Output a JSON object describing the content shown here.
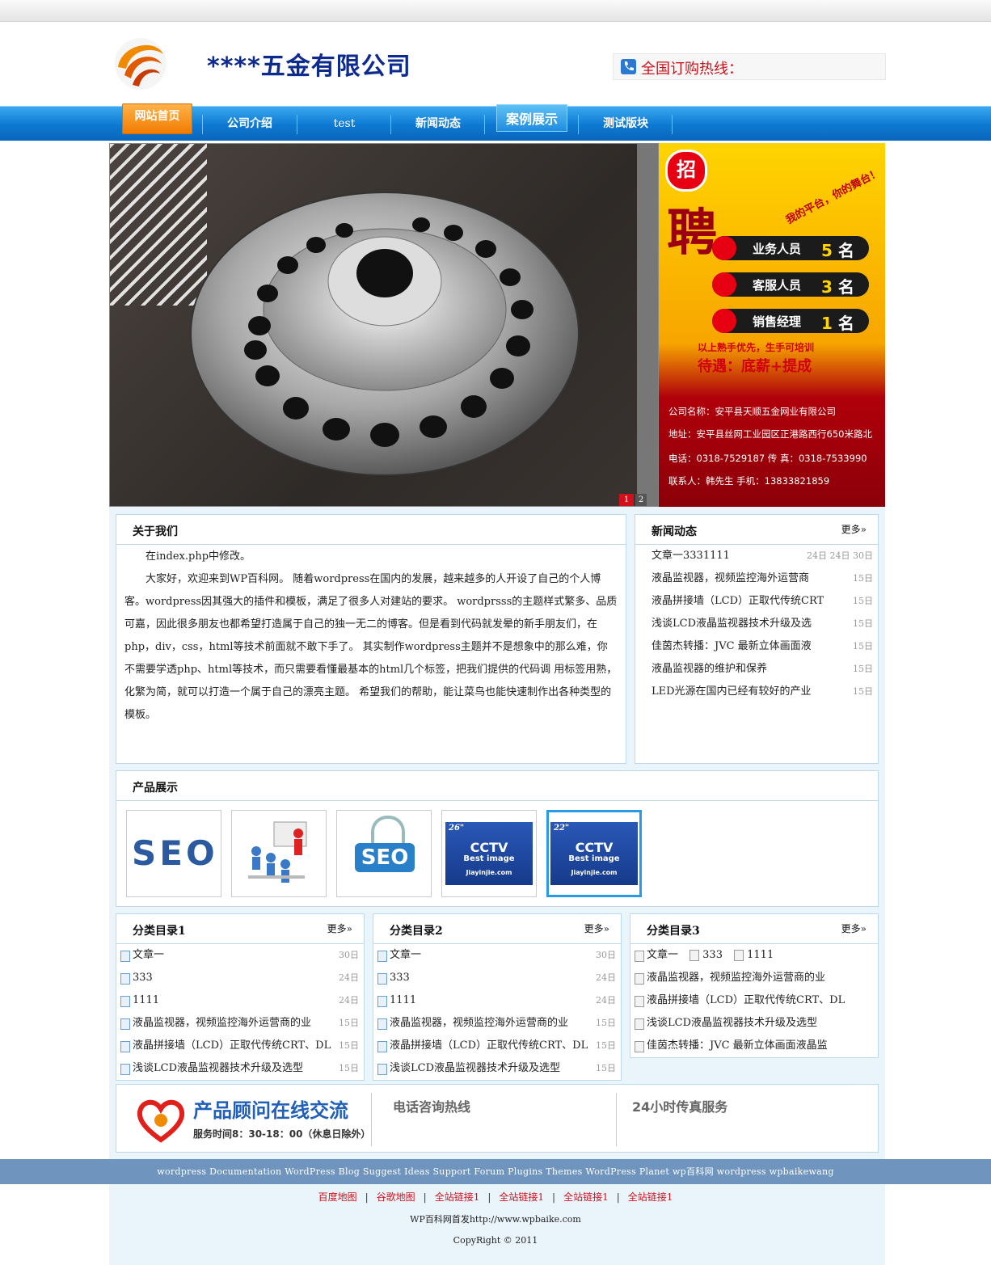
{
  "header": {
    "site_title": "****五金有限公司",
    "hotline_label": "全国订购热线：",
    "brand_color": "#0d2b8f",
    "hotline_color": "#d0101a"
  },
  "nav": {
    "items": [
      "网站首页",
      "公司介绍",
      "test",
      "新闻动态",
      "案例展示",
      "测试版块"
    ],
    "active_bg": "#f07c00",
    "bar_color": "#0d78d2"
  },
  "banner": {
    "pager": [
      "1",
      "2"
    ],
    "ad": {
      "badge": "招",
      "headline": "聘",
      "slogan": "我的平台，你的舞台！",
      "positions": [
        {
          "role": "业务人员",
          "count": "5",
          "unit": "名"
        },
        {
          "role": "客服人员",
          "count": "3",
          "unit": "名"
        },
        {
          "role": "销售经理",
          "count": "1",
          "unit": "名"
        }
      ],
      "perk_line1": "以上熟手优先，生手可培训",
      "perk_line2": "待遇：底薪+提成",
      "info": [
        "公司名称：安平县天顺五金网业有限公司",
        "地址：安平县丝网工业园区正港路西行650米路北",
        "电话：0318-7529187 传 真：0318-7533990",
        "联系人：韩先生 手机：13833821859"
      ]
    }
  },
  "about": {
    "title": "关于我们",
    "paragraphs": [
      "在index.php中修改。",
      "大家好，欢迎来到WP百科网。 随着wordpress在国内的发展，越来越多的人开设了自己的个人博客。wordpress因其强大的插件和模板，满足了很多人对建站的要求。 wordprsss的主题样式繁多、品质可嘉，因此很多朋友也都希望打造属于自己的独一无二的博客。但是看到代码就发晕的新手朋友们，在 php，div，css，html等技术前面就不敢下手了。 其实制作wordpress主题并不是想象中的那么难，你不需要学透php、html等技术，而只需要看懂最基本的html几个标签，把我们提供的代码调 用标签用熟，化繁为简，就可以打造一个属于自己的漂亮主题。 希望我们的帮助，能让菜鸟也能快速制作出各种类型的模板。"
    ]
  },
  "news": {
    "title": "新闻动态",
    "more": "更多»",
    "items": [
      {
        "text": "文章一3331111",
        "date": "24日 24日 30日"
      },
      {
        "text": "液晶监视器，视频监控海外运营商",
        "date": "15日"
      },
      {
        "text": "液晶拼接墙（LCD）正取代传统CRT",
        "date": "15日"
      },
      {
        "text": "浅谈LCD液晶监视器技术升级及选",
        "date": "15日"
      },
      {
        "text": "佳茵杰转播：JVC 最新立体画面液",
        "date": "15日"
      },
      {
        "text": "液晶监视器的维护和保养",
        "date": "15日"
      },
      {
        "text": "LED光源在国内已经有较好的产业",
        "date": "15日"
      }
    ]
  },
  "products": {
    "title": "产品展示",
    "items": [
      {
        "label": "SEO"
      },
      {
        "label": ""
      },
      {
        "label": "SEO"
      },
      {
        "size": "26\"",
        "line1": "CCTV",
        "line2": "Best image",
        "line3": "Jiayinjie.com"
      },
      {
        "size": "22\"",
        "line1": "CCTV",
        "line2": "Best image",
        "line3": "Jiayinjie.com"
      }
    ]
  },
  "cat1": {
    "title": "分类目录1",
    "more": "更多»",
    "items": [
      {
        "text": "文章一",
        "date": "30日"
      },
      {
        "text": "333",
        "date": "24日"
      },
      {
        "text": "1111",
        "date": "24日"
      },
      {
        "text": "液晶监视器，视频监控海外运营商的业",
        "date": "15日"
      },
      {
        "text": "液晶拼接墙（LCD）正取代传统CRT、DL",
        "date": "15日"
      },
      {
        "text": "浅谈LCD液晶监视器技术升级及选型",
        "date": "15日"
      }
    ]
  },
  "cat2": {
    "title": "分类目录2",
    "more": "更多»",
    "items": [
      {
        "text": "文章一",
        "date": "30日"
      },
      {
        "text": "333",
        "date": "24日"
      },
      {
        "text": "1111",
        "date": "24日"
      },
      {
        "text": "液晶监视器，视频监控海外运营商的业",
        "date": "15日"
      },
      {
        "text": "液晶拼接墙（LCD）正取代传统CRT、DL",
        "date": "15日"
      },
      {
        "text": "浅谈LCD液晶监视器技术升级及选型",
        "date": "15日"
      }
    ]
  },
  "cat3": {
    "title": "分类目录3",
    "more": "更多»",
    "first_row": [
      "文章一",
      "333",
      "1111"
    ],
    "items": [
      {
        "text": "液晶监视器，视频监控海外运营商的业"
      },
      {
        "text": "液晶拼接墙（LCD）正取代传统CRT、DL"
      },
      {
        "text": "浅谈LCD液晶监视器技术升级及选型"
      },
      {
        "text": "佳茵杰转播：JVC 最新立体画面液晶监"
      }
    ]
  },
  "service": {
    "consult_title": "产品顾问在线交流",
    "hours": "服务时间8：30-18：00（休息日除外）",
    "phone_title": "电话咨询热线",
    "fax_title": "24小时传真服务"
  },
  "footer": {
    "links_line": "wordpress Documentation WordPress Blog Suggest Ideas Support Forum Plugins Themes WordPress Planet wp百科网 wordpress wpbaikewang",
    "friend_links": [
      "百度地图",
      "谷歌地图",
      "全站链接1",
      "全站链接1",
      "全站链接1",
      "全站链接1"
    ],
    "first_publish": "WP百科网首发http://www.wpbaike.com",
    "copyright": "CopyRight © 2011"
  }
}
